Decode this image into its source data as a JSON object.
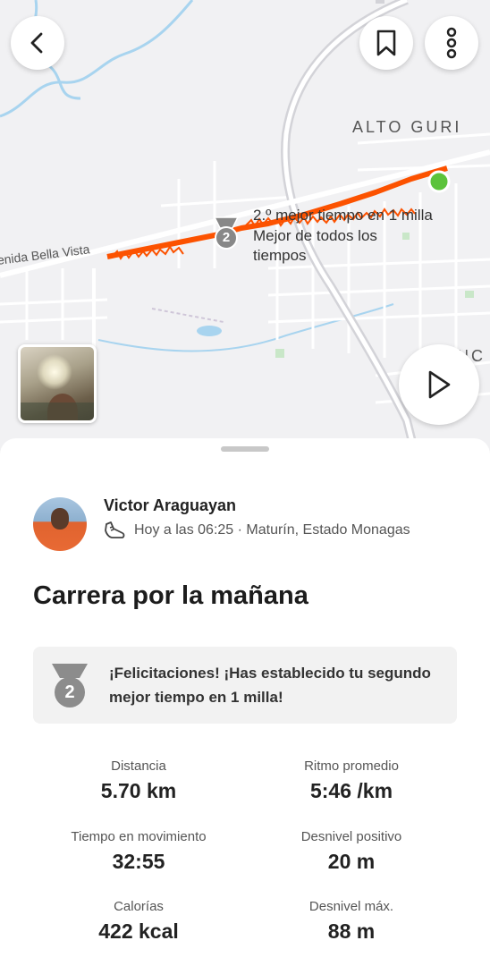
{
  "map": {
    "place_label": "ALTO GURI",
    "street_label": "enida Bella Vista",
    "segment_rank": "2",
    "segment_note": [
      "2.º mejor tiempo en 1 milla",
      "Mejor de todos los",
      "tiempos"
    ],
    "partial_label": "NC",
    "route_color": "#fc5200"
  },
  "buttons": {
    "back_icon": "chevron-left-icon",
    "bookmark_icon": "bookmark-icon",
    "more_icon": "more-vertical-icon",
    "play_icon": "play-icon"
  },
  "athlete": {
    "name": "Victor Araguayan",
    "when_where": "Hoy a las 06:25 · Maturín, Estado Monagas"
  },
  "activity": {
    "title": "Carrera por la mañana"
  },
  "achievement": {
    "rank": "2",
    "text": "¡Felicitaciones! ¡Has establecido tu segundo mejor tiempo en 1 milla!"
  },
  "stats": [
    {
      "label": "Distancia",
      "value": "5.70 km"
    },
    {
      "label": "Ritmo promedio",
      "value": "5:46 /km"
    },
    {
      "label": "Tiempo en movimiento",
      "value": "32:55"
    },
    {
      "label": "Desnivel positivo",
      "value": "20 m"
    },
    {
      "label": "Calorías",
      "value": "422 kcal"
    },
    {
      "label": "Desnivel máx.",
      "value": "88 m"
    }
  ]
}
